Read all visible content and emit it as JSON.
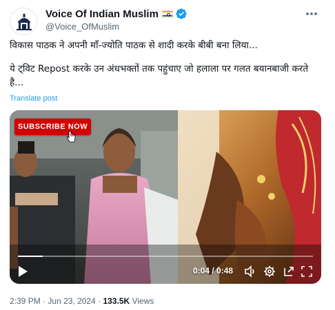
{
  "author": {
    "display_name": "Voice Of Indian Muslim",
    "handle": "@Voice_OfMuslim",
    "verified": true,
    "flag": "india-flag-icon"
  },
  "tweet": {
    "line1": "विकास पाठक ने अपनी माँ-ज्योति पाठक से शादी करके बीबी बना लिया...",
    "line2": "ये ट्विट Repost करके उन अंधभक्तों तक पहुंचाए जो हलाला पर गलत बयानबाजी करते है...",
    "translate_label": "Translate post"
  },
  "video": {
    "overlay_label": "SUBSCRIBE NOW",
    "current_time": "0:04",
    "duration": "0:48",
    "time_display": "0:04 / 0:48",
    "progress_fraction": 0.083
  },
  "footer": {
    "time": "2:39 PM",
    "date": "Jun 23, 2024",
    "separator": "·",
    "views_count": "133.5K",
    "views_label": "Views"
  },
  "colors": {
    "accent": "#1d9bf0",
    "verified": "#1d9bf0",
    "subscribe_red": "#d40000",
    "muted_text": "#536471"
  }
}
